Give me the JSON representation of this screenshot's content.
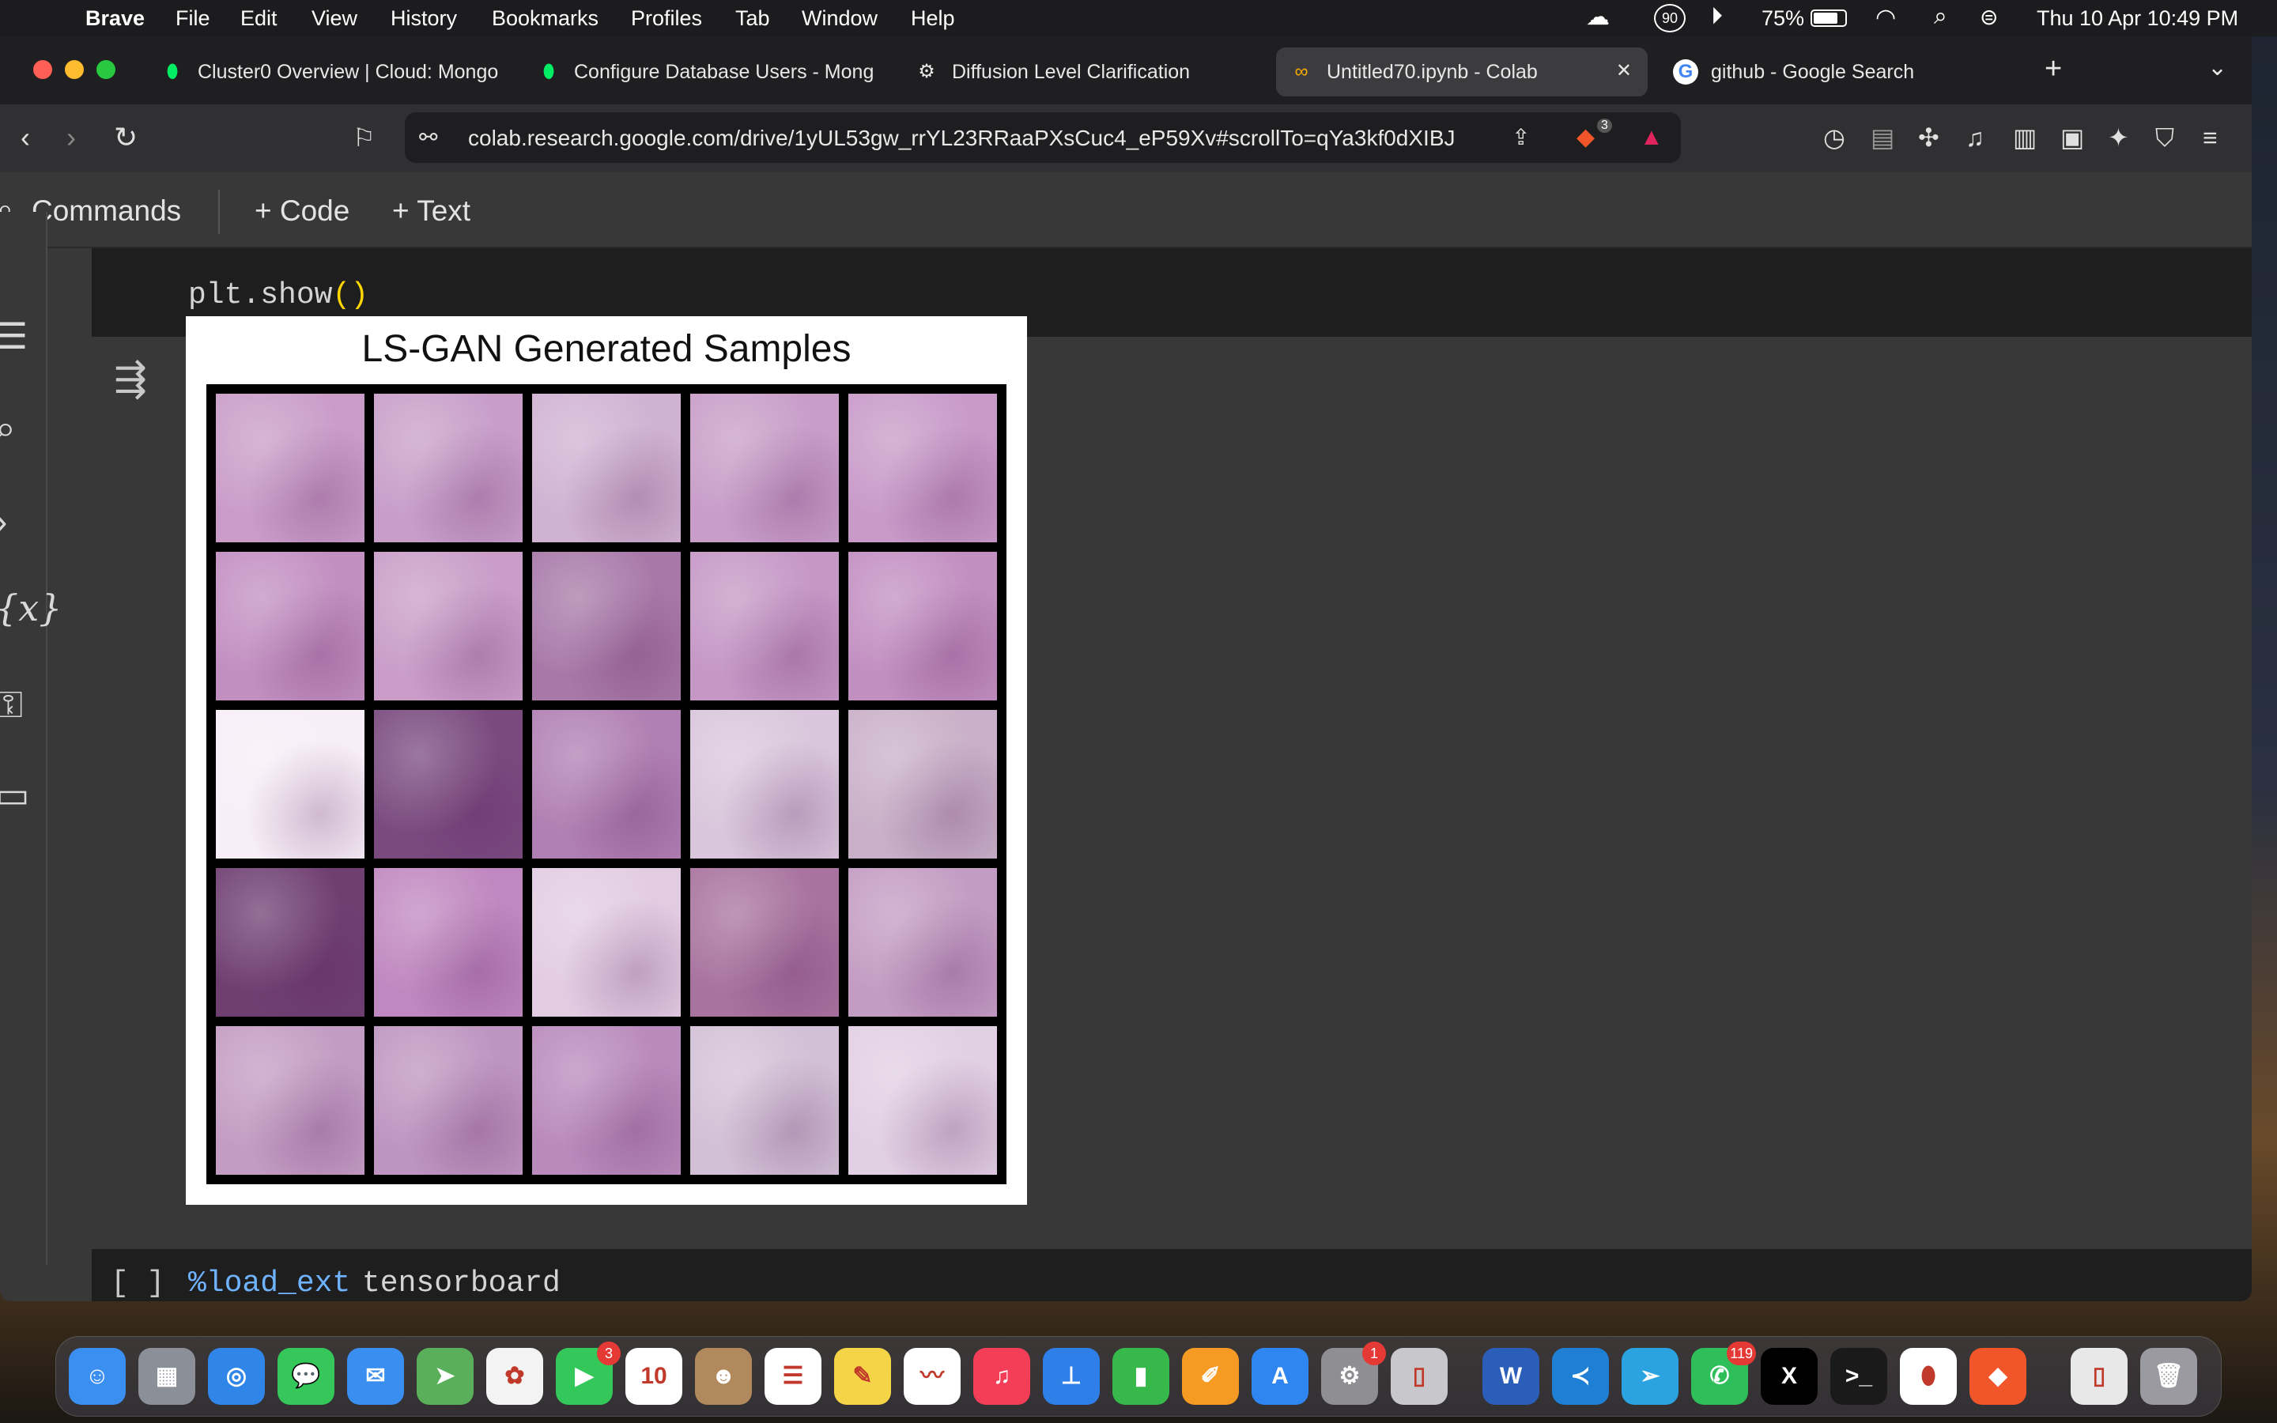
{
  "menubar": {
    "app": "Brave",
    "items": [
      "File",
      "Edit",
      "View",
      "History",
      "Bookmarks",
      "Profiles",
      "Tab",
      "Window",
      "Help"
    ],
    "battery": "75%",
    "clock": "Thu 10 Apr  10:49 PM",
    "status_badge": "90"
  },
  "tabs": [
    {
      "title": "Cluster0 Overview | Cloud: Mongo",
      "icon": "mongodb-leaf-icon"
    },
    {
      "title": "Configure Database Users - Mong",
      "icon": "mongodb-leaf-icon"
    },
    {
      "title": "Diffusion Level Clarification",
      "icon": "openai-icon"
    },
    {
      "title": "Untitled70.ipynb - Colab",
      "icon": "colab-icon",
      "active": true,
      "close": "✕"
    },
    {
      "title": "github - Google Search",
      "icon": "google-icon"
    }
  ],
  "new_tab": "+",
  "url": "colab.research.google.com/drive/1yUL53gw_rrYL23RRaaPXsCuc4_eP59Xv#scrollTo=qYa3kf0dXIBJ",
  "shields_count": "3",
  "colab": {
    "commands": "Commands",
    "add_code": "+ Code",
    "add_text": "+ Text"
  },
  "sidebar_vars": "{x}",
  "cell_code": {
    "obj": "plt",
    "method": ".show",
    "parens": "()"
  },
  "figure": {
    "title": "LS-GAN Generated Samples",
    "colors": [
      [
        "#c99cc8",
        "#c89ec9",
        "#d0b2d2",
        "#c89dc8",
        "#c89ac8"
      ],
      [
        "#c28fc1",
        "#c99dc8",
        "#a879a8",
        "#c597c5",
        "#c28fc1"
      ],
      [
        "#f7eef7",
        "#7a4a7f",
        "#b07fb3",
        "#d9c6dc",
        "#c9b0c8"
      ],
      [
        "#6f3f72",
        "#c088c0",
        "#e2cce2",
        "#a8739f",
        "#c39cc3"
      ],
      [
        "#c39cc3",
        "#be95c0",
        "#b98abc",
        "#d2c0d6",
        "#e1cfe3"
      ]
    ]
  },
  "next_cell": {
    "bracket": "[ ]",
    "magic": "%load_ext",
    "arg": "tensorboard"
  },
  "dock": [
    {
      "name": "finder",
      "color": "#3b8ff0",
      "glyph": "☺"
    },
    {
      "name": "launchpad",
      "color": "#8a8f98",
      "glyph": "▦"
    },
    {
      "name": "safari",
      "color": "#2f86e8",
      "glyph": "◎"
    },
    {
      "name": "messages",
      "color": "#35c759",
      "glyph": "💬"
    },
    {
      "name": "mail",
      "color": "#3a8ef0",
      "glyph": "✉"
    },
    {
      "name": "maps",
      "color": "#5ab05a",
      "glyph": "➤"
    },
    {
      "name": "photos",
      "color": "#f3f3f3",
      "glyph": "✿"
    },
    {
      "name": "facetime",
      "color": "#34c759",
      "glyph": "▶",
      "badge": "3"
    },
    {
      "name": "calendar",
      "color": "#ffffff",
      "glyph": "10"
    },
    {
      "name": "contacts",
      "color": "#b08a5c",
      "glyph": "☻"
    },
    {
      "name": "reminders",
      "color": "#ffffff",
      "glyph": "☰"
    },
    {
      "name": "notes",
      "color": "#f5d547",
      "glyph": "✎"
    },
    {
      "name": "freeform",
      "color": "#ffffff",
      "glyph": "〰"
    },
    {
      "name": "music",
      "color": "#f43e57",
      "glyph": "♫"
    },
    {
      "name": "keynote",
      "color": "#2f7fe8",
      "glyph": "⊥"
    },
    {
      "name": "numbers",
      "color": "#36b84a",
      "glyph": "▮"
    },
    {
      "name": "pages",
      "color": "#f59a23",
      "glyph": "✐"
    },
    {
      "name": "app-store",
      "color": "#2f86f0",
      "glyph": "A"
    },
    {
      "name": "system-settings",
      "color": "#8e8e93",
      "glyph": "⚙",
      "badge": "1"
    },
    {
      "name": "iphone-mirroring",
      "color": "#c8c8cc",
      "glyph": "▯"
    },
    {
      "name": "word",
      "color": "#2b5eb8",
      "glyph": "W"
    },
    {
      "name": "vscode",
      "color": "#1f7fd4",
      "glyph": "≺"
    },
    {
      "name": "telegram",
      "color": "#2aa3e0",
      "glyph": "➢"
    },
    {
      "name": "whatsapp",
      "color": "#2fbf5a",
      "glyph": "✆",
      "badge": "119"
    },
    {
      "name": "x",
      "color": "#000000",
      "glyph": "X"
    },
    {
      "name": "terminal",
      "color": "#1a1a1a",
      "glyph": ">_"
    },
    {
      "name": "mongodb-compass",
      "color": "#ffffff",
      "glyph": "⬮"
    },
    {
      "name": "brave",
      "color": "#f0562a",
      "glyph": "◆"
    },
    {
      "name": "document",
      "color": "#e8e8e8",
      "glyph": "▯"
    },
    {
      "name": "trash",
      "color": "#9a9aa0",
      "glyph": "🗑"
    }
  ]
}
